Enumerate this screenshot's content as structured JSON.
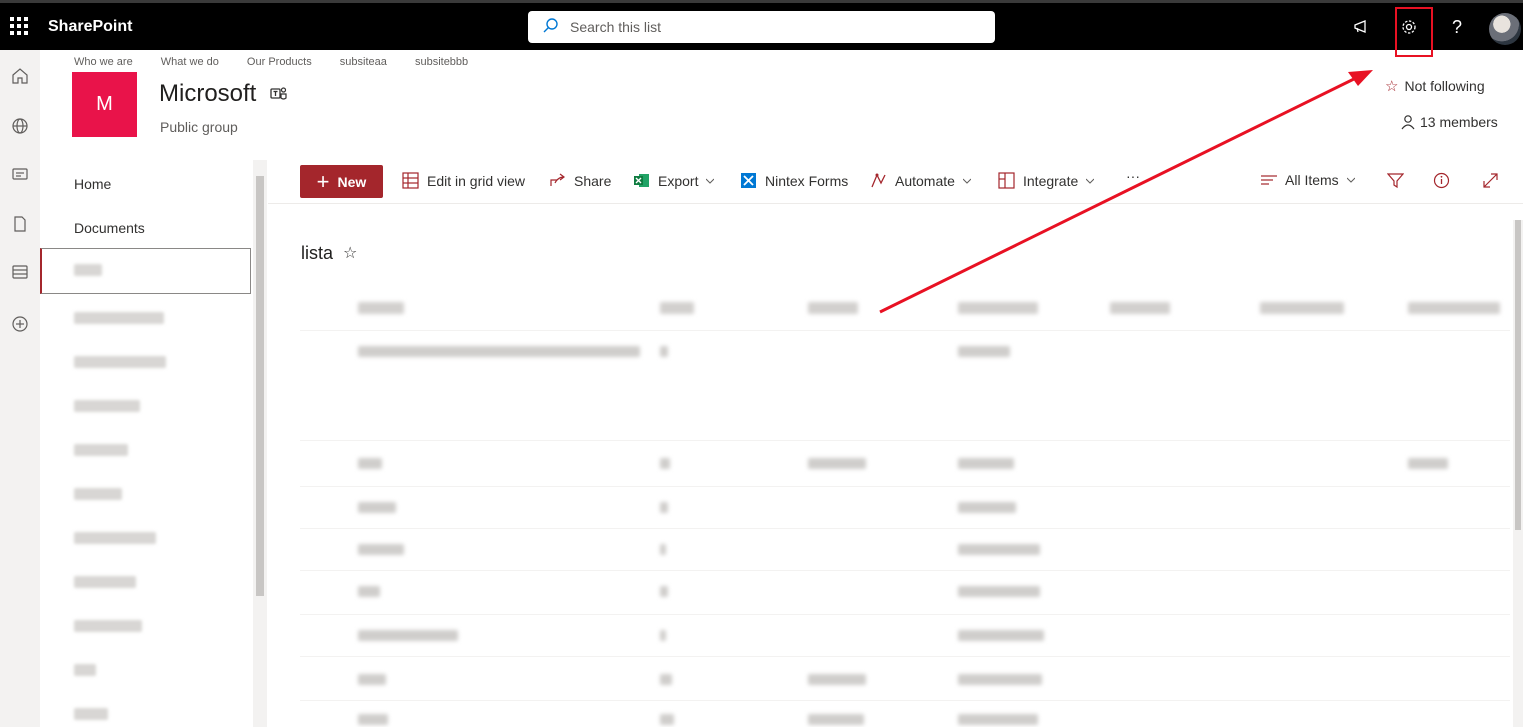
{
  "suitebar": {
    "brand": "SharePoint",
    "search_placeholder": "Search this list",
    "help": "?"
  },
  "site": {
    "topnav": [
      "Who we are",
      "What we do",
      "Our Products",
      "subsiteaa",
      "subsitebbb"
    ],
    "logo_letter": "M",
    "title": "Microsoft",
    "subtitle": "Public group",
    "follow_label": "Not following",
    "members_label": "13 members"
  },
  "sitenav": {
    "items": [
      "Home",
      "Documents"
    ]
  },
  "commandbar": {
    "new_label": "New",
    "edit_grid": "Edit in grid view",
    "share": "Share",
    "export": "Export",
    "nintex": "Nintex Forms",
    "automate": "Automate",
    "integrate": "Integrate",
    "more": "···",
    "view": "All Items"
  },
  "list": {
    "title": "lista"
  },
  "colors": {
    "accent": "#a4262c",
    "logo": "#e9134a",
    "annotation": "#e81123"
  }
}
